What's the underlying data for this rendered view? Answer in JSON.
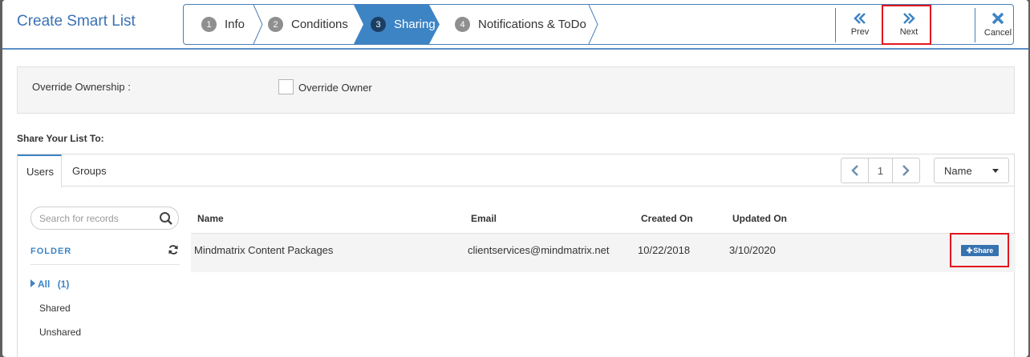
{
  "header": {
    "title": "Create Smart List"
  },
  "wizard": {
    "steps": [
      {
        "num": "1",
        "label": "Info"
      },
      {
        "num": "2",
        "label": "Conditions"
      },
      {
        "num": "3",
        "label": "Sharing"
      },
      {
        "num": "4",
        "label": "Notifications & ToDo"
      }
    ],
    "active_step": "Sharing",
    "prev_label": "Prev",
    "next_label": "Next",
    "cancel_label": "Cancel"
  },
  "override": {
    "label": "Override Ownership :",
    "checkbox_label": "Override Owner",
    "checked": false
  },
  "share": {
    "title": "Share Your List To:",
    "tabs": [
      "Users",
      "Groups"
    ],
    "active_tab": "Users",
    "page": "1",
    "sort_value": "Name",
    "search_placeholder": "Search for records",
    "folder_title": "FOLDER",
    "folders": [
      {
        "label": "All",
        "count": "(1)"
      },
      {
        "label": "Shared"
      },
      {
        "label": "Unshared"
      }
    ],
    "columns": [
      "Name",
      "Email",
      "Created On",
      "Updated On"
    ],
    "rows": [
      {
        "name": "Mindmatrix Content Packages",
        "email": "clientservices@mindmatrix.net",
        "created": "10/22/2018",
        "updated": "3/10/2020",
        "action": "Share"
      }
    ]
  },
  "colors": {
    "accent": "#3d84c5",
    "highlight": "#e3161f",
    "step_badge": "#8f8f8f"
  }
}
